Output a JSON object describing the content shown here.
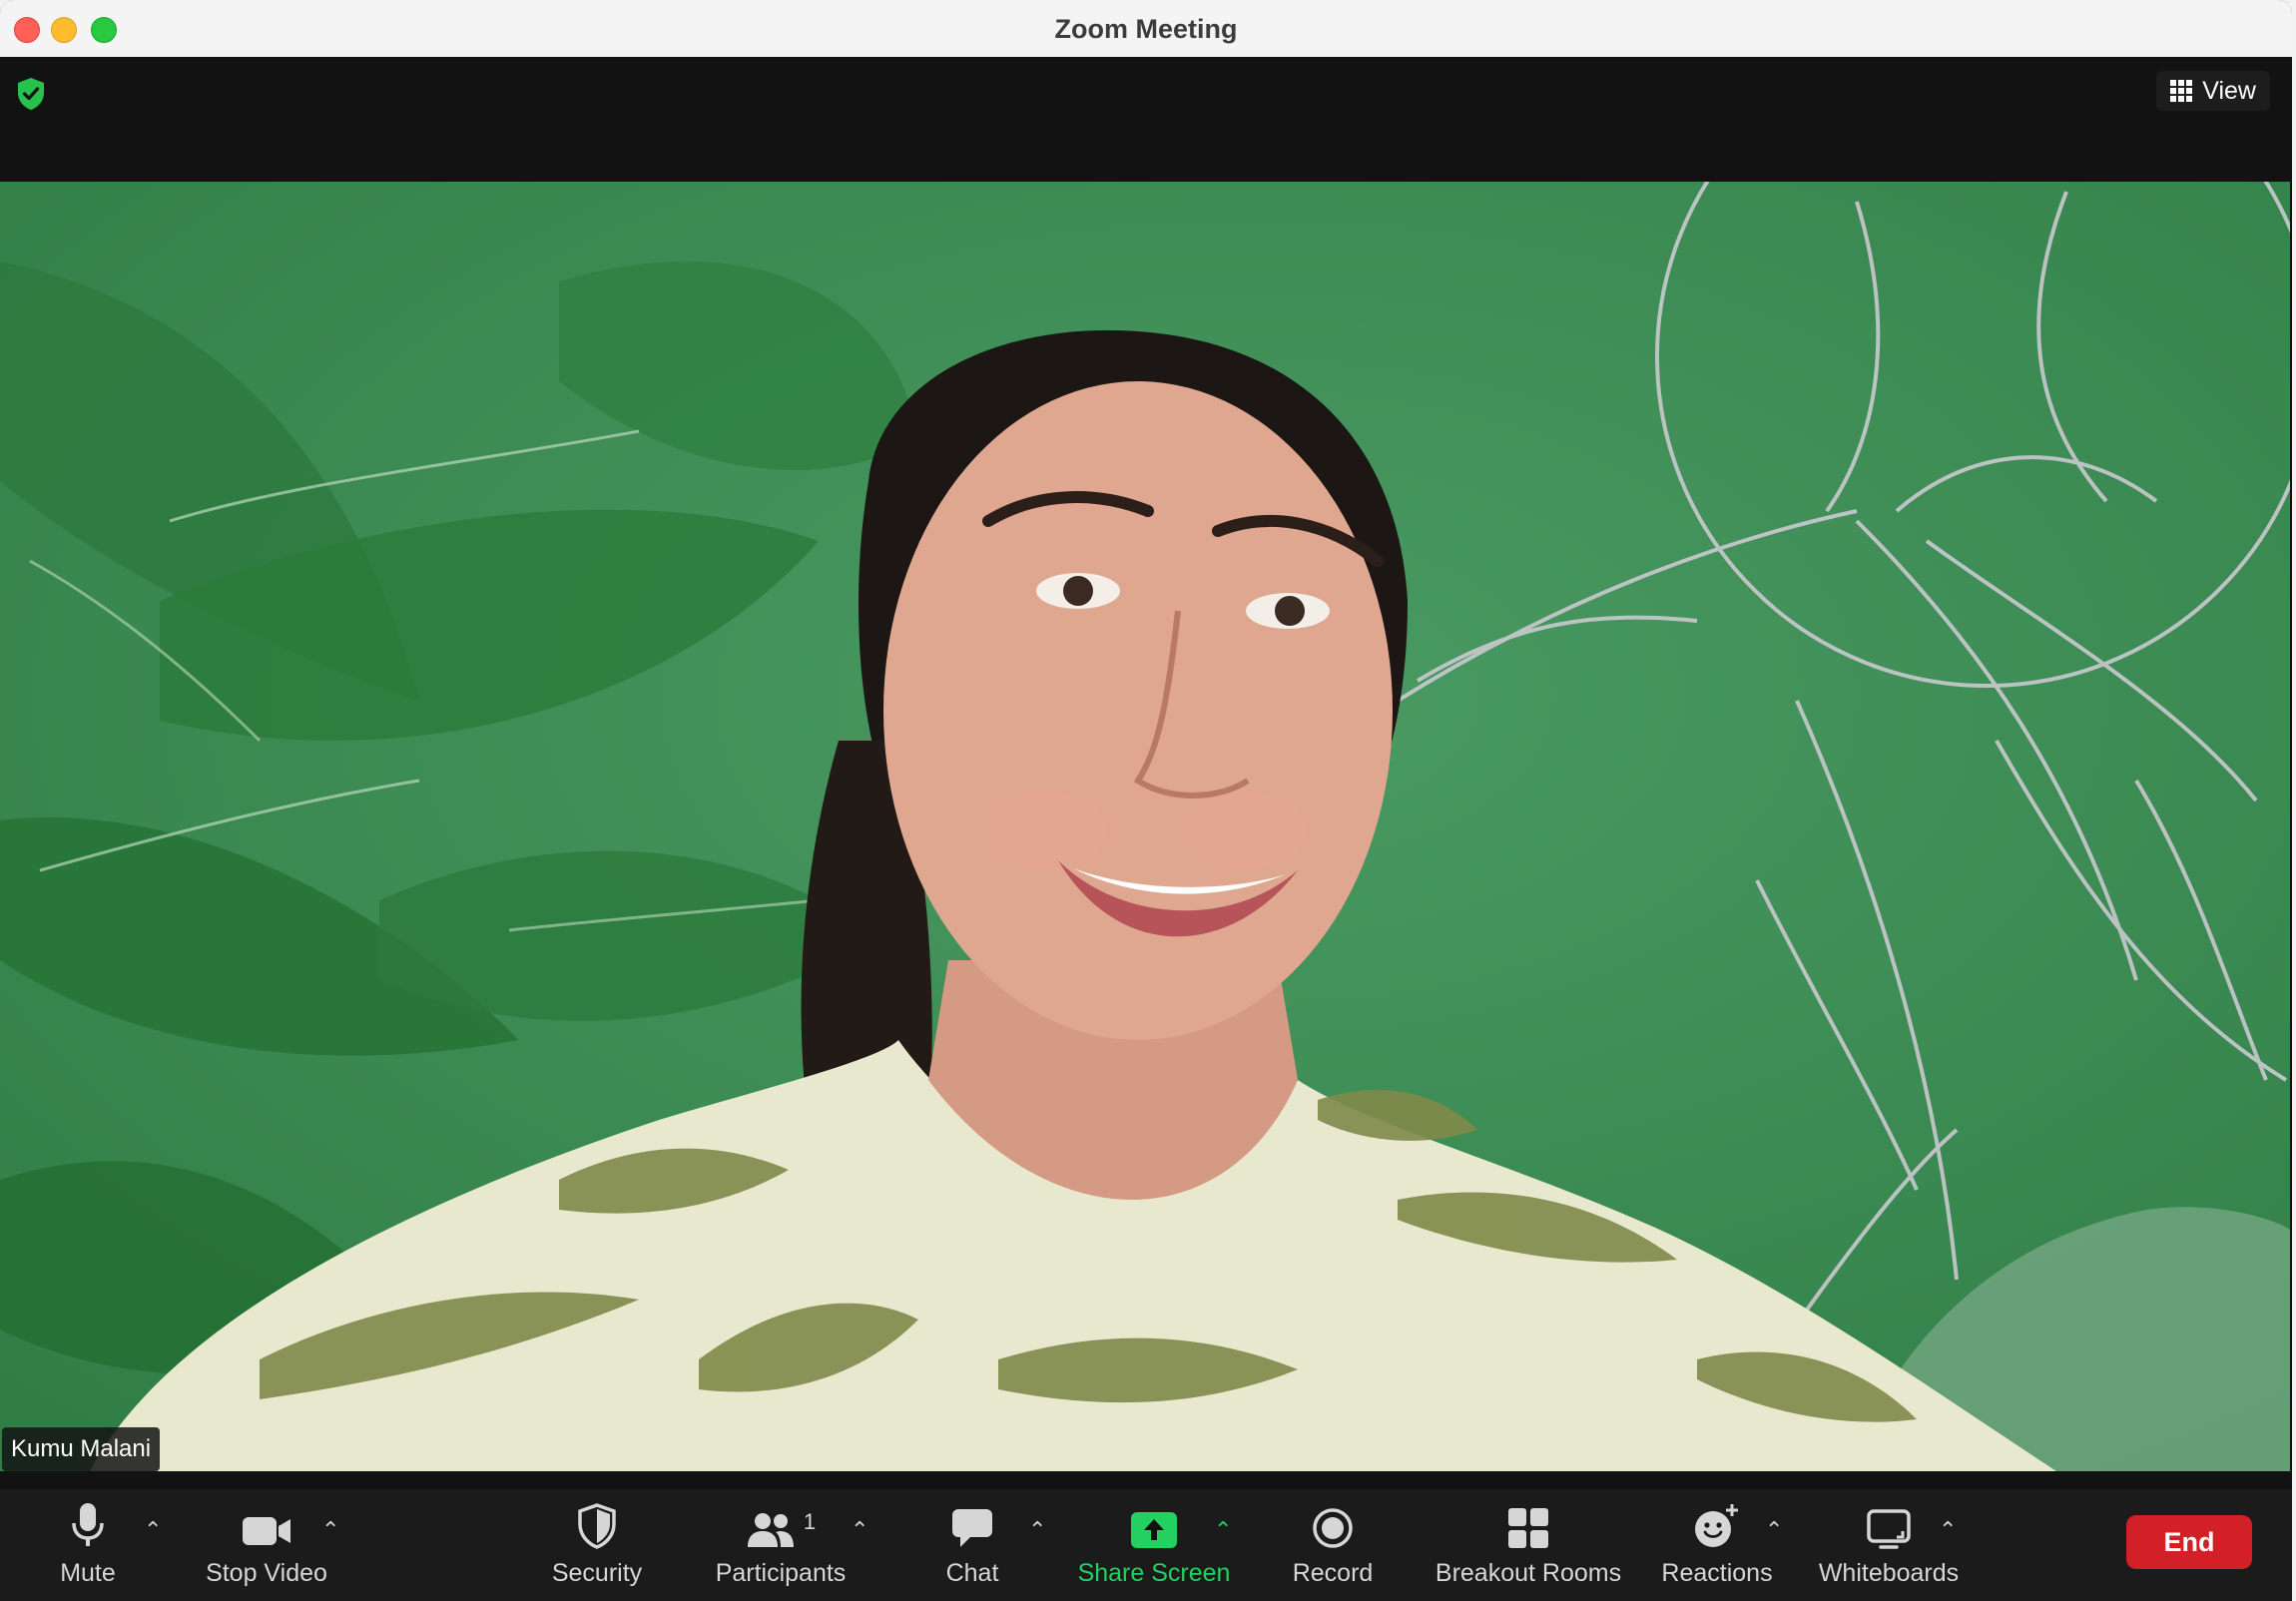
{
  "window": {
    "title": "Zoom Meeting"
  },
  "topbar": {
    "view_label": "View"
  },
  "video": {
    "participant_name": "Kumu Malani"
  },
  "toolbar": {
    "mute": "Mute",
    "stop_video": "Stop Video",
    "security": "Security",
    "participants": "Participants",
    "participants_count": "1",
    "chat": "Chat",
    "share_screen": "Share Screen",
    "record": "Record",
    "breakout_rooms": "Breakout Rooms",
    "reactions": "Reactions",
    "whiteboards": "Whiteboards",
    "end": "End"
  },
  "colors": {
    "share_green": "#23d160",
    "end_red": "#d32027",
    "secure_shield": "#27c24c",
    "video_background": "#3f8a56"
  },
  "icons": [
    "shield-check-icon",
    "view-grid-icon",
    "microphone-icon",
    "video-camera-icon",
    "security-shield-icon",
    "participants-icon",
    "chat-bubble-icon",
    "share-screen-icon",
    "record-icon",
    "breakout-rooms-icon",
    "reactions-icon",
    "whiteboard-icon",
    "caret-up-icon"
  ]
}
